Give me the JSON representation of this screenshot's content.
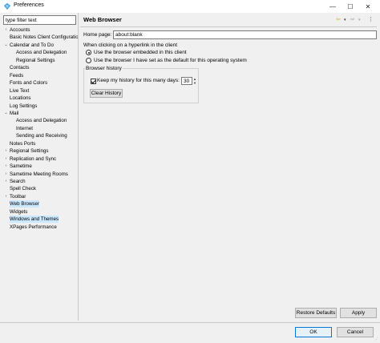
{
  "window": {
    "title": "Preferences",
    "minimize_glyph": "—",
    "maximize_glyph": "☐",
    "close_glyph": "✕"
  },
  "filter": {
    "value": "type filter text"
  },
  "tree": [
    {
      "label": "Accounts",
      "level": 1,
      "arrow": "›"
    },
    {
      "label": "Basic Notes Client Configuration",
      "level": 1,
      "arrow": ""
    },
    {
      "label": "Calendar and To Do",
      "level": 1,
      "arrow": "⌄"
    },
    {
      "label": "Access and Delegation",
      "level": 2,
      "arrow": ""
    },
    {
      "label": "Regional Settings",
      "level": 2,
      "arrow": ""
    },
    {
      "label": "Contacts",
      "level": 1,
      "arrow": ""
    },
    {
      "label": "Feeds",
      "level": 1,
      "arrow": ""
    },
    {
      "label": "Fonts and Colors",
      "level": 1,
      "arrow": ""
    },
    {
      "label": "Live Text",
      "level": 1,
      "arrow": ""
    },
    {
      "label": "Locations",
      "level": 1,
      "arrow": ""
    },
    {
      "label": "Log Settings",
      "level": 1,
      "arrow": ""
    },
    {
      "label": "Mail",
      "level": 1,
      "arrow": "⌄"
    },
    {
      "label": "Access and Delegation",
      "level": 2,
      "arrow": ""
    },
    {
      "label": "Internet",
      "level": 2,
      "arrow": ""
    },
    {
      "label": "Sending and Receiving",
      "level": 2,
      "arrow": ""
    },
    {
      "label": "Notes Ports",
      "level": 1,
      "arrow": ""
    },
    {
      "label": "Regional Settings",
      "level": 1,
      "arrow": "›"
    },
    {
      "label": "Replication and Sync",
      "level": 1,
      "arrow": "›"
    },
    {
      "label": "Sametime",
      "level": 1,
      "arrow": "›"
    },
    {
      "label": "Sametime Meeting Rooms",
      "level": 1,
      "arrow": "›"
    },
    {
      "label": "Search",
      "level": 1,
      "arrow": "›"
    },
    {
      "label": "Spell Check",
      "level": 1,
      "arrow": ""
    },
    {
      "label": "Toolbar",
      "level": 1,
      "arrow": "›"
    },
    {
      "label": "Web Browser",
      "level": 1,
      "arrow": "",
      "selected": true
    },
    {
      "label": "Widgets",
      "level": 1,
      "arrow": ""
    },
    {
      "label": "Windows and Themes",
      "level": 1,
      "arrow": "",
      "selected": true
    },
    {
      "label": "XPages Performance",
      "level": 1,
      "arrow": ""
    }
  ],
  "page": {
    "title": "Web Browser",
    "nav_back": "⇦",
    "nav_back_menu": "▾",
    "nav_fwd": "⇨",
    "nav_fwd_menu": "▾",
    "nav_more": "⋮",
    "home_label": "Home page:",
    "home_value": "about:blank",
    "hyperlink_label": "When clicking on a hyperlink in the client",
    "radio_embedded": "Use the browser embedded in this client",
    "radio_default": "Use the browser I have set as the default for this operating system",
    "history_group": "Browser history",
    "keep_history_label": "Keep my history for this many days:",
    "history_days": "30",
    "spin_up": "▲",
    "spin_down": "▼",
    "clear_history": "Clear History"
  },
  "buttons": {
    "restore_defaults": "Restore Defaults",
    "apply": "Apply",
    "ok": "OK",
    "cancel": "Cancel"
  },
  "colors": {
    "selection": "#cce8ff",
    "accent": "#0078d7",
    "nav_back": "#e8a317",
    "disabled": "#a0a0a0"
  }
}
